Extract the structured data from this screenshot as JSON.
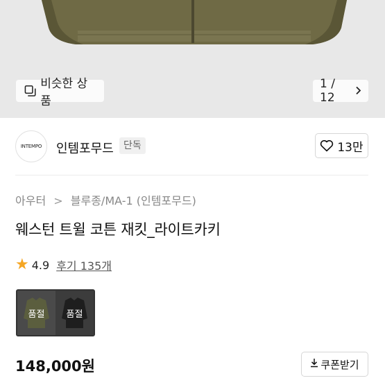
{
  "gallery": {
    "similar_label": "비슷한 상품",
    "pager_text": "1 / 12",
    "pager_icon": "chevron-right-icon",
    "similar_icon": "copy-icon"
  },
  "brand": {
    "logo_text": "INTEMPO",
    "name": "인템포무드",
    "badge": "단독",
    "like_count": "13만"
  },
  "breadcrumb": {
    "level1": "아우터",
    "separator": ">",
    "level2": "블루종/MA-1 (인템포무드)"
  },
  "product": {
    "title": "웨스턴 트윌 코튼 재킷_라이트카키",
    "rating": "4.9",
    "reviews_label": "후기 135개",
    "price": "148,000원"
  },
  "options": [
    {
      "label": "품절",
      "color": "#5b5e3e"
    },
    {
      "label": "품절",
      "color": "#1e1e1e"
    }
  ],
  "coupon": {
    "label": "쿠폰받기"
  },
  "colors": {
    "star": "#f5a623",
    "hero_bg": "#e8e8e8",
    "khaki": "#6f6a45"
  }
}
